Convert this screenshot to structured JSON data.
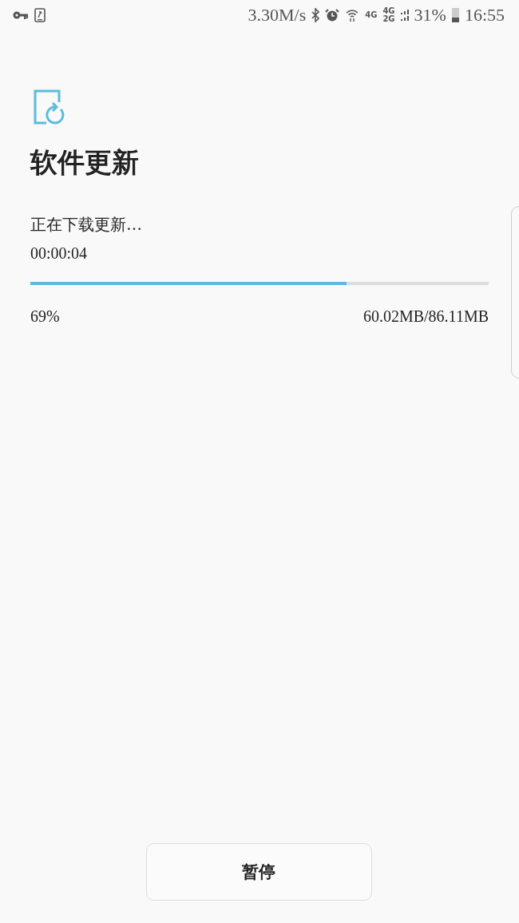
{
  "status_bar": {
    "speed": "3.30M/s",
    "network_labels": [
      "4G",
      "4G",
      "2G"
    ],
    "battery": "31%",
    "time": "16:55"
  },
  "title": "软件更新",
  "download": {
    "status": "正在下载更新…",
    "elapsed": "00:00:04",
    "level": 0.69,
    "percent": "69%",
    "size": "60.02MB/86.11MB"
  },
  "button": "暂停"
}
